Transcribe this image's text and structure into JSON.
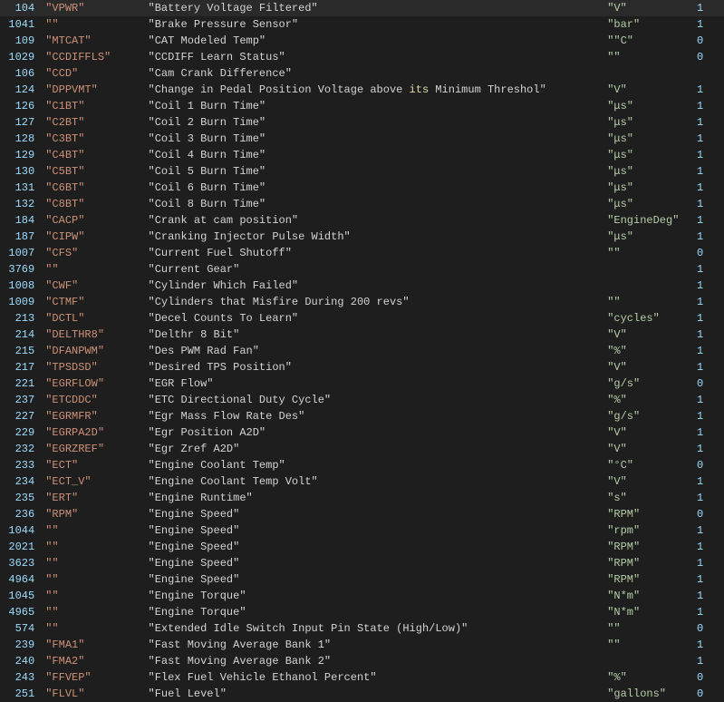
{
  "rows": [
    {
      "id": "104",
      "code": "\"VPWR\"",
      "desc": "\"Battery Voltage Filtered\"",
      "unit": "\"V\"",
      "extra": "",
      "val": "1"
    },
    {
      "id": "1041",
      "code": "\"\"",
      "desc": "\"Brake Pressure Sensor\"",
      "unit": "\"bar\"",
      "extra": "",
      "val": "1"
    },
    {
      "id": "109",
      "code": "\"MTCAT\"",
      "desc": "\"CAT Modeled Temp\"",
      "unit": "\"\"C\"",
      "extra": "",
      "val": "0"
    },
    {
      "id": "1029",
      "code": "\"CCDIFFLS\"",
      "desc": "\"CCDIFF Learn Status\"",
      "unit": "\"\"",
      "extra": "",
      "val": "0"
    },
    {
      "id": "106",
      "code": "\"CCD\"",
      "desc": "\"Cam Crank Difference\"",
      "unit": "",
      "extra": "",
      "val": ""
    },
    {
      "id": "124",
      "code": "\"DPPVMT\"",
      "desc": "\"Change in Pedal Position Voltage above its Minimum Threshol\"",
      "unit": "\"V\"",
      "extra": "",
      "val": "1"
    },
    {
      "id": "126",
      "code": "\"C1BT\"",
      "desc": "\"Coil 1 Burn Time\"",
      "unit": "\"μs\"",
      "extra": "",
      "val": "1"
    },
    {
      "id": "127",
      "code": "\"C2BT\"",
      "desc": "\"Coil 2 Burn Time\"",
      "unit": "\"μs\"",
      "extra": "",
      "val": "1"
    },
    {
      "id": "128",
      "code": "\"C3BT\"",
      "desc": "\"Coil 3 Burn Time\"",
      "unit": "\"μs\"",
      "extra": "",
      "val": "1"
    },
    {
      "id": "129",
      "code": "\"C4BT\"",
      "desc": "\"Coil 4 Burn Time\"",
      "unit": "\"μs\"",
      "extra": "",
      "val": "1"
    },
    {
      "id": "130",
      "code": "\"C5BT\"",
      "desc": "\"Coil 5 Burn Time\"",
      "unit": "\"μs\"",
      "extra": "",
      "val": "1"
    },
    {
      "id": "131",
      "code": "\"C6BT\"",
      "desc": "\"Coil 6 Burn Time\"",
      "unit": "\"μs\"",
      "extra": "",
      "val": "1"
    },
    {
      "id": "132",
      "code": "\"C8BT\"",
      "desc": "\"Coil 8 Burn Time\"",
      "unit": "\"μs\"",
      "extra": "",
      "val": "1"
    },
    {
      "id": "184",
      "code": "\"CACP\"",
      "desc": "\"Crank at cam position\"",
      "unit": "\"EngineDeg\"",
      "extra": "",
      "val": "1"
    },
    {
      "id": "187",
      "code": "\"CIPW\"",
      "desc": "\"Cranking Injector Pulse Width\"",
      "unit": "\"μs\"",
      "extra": "",
      "val": "1"
    },
    {
      "id": "1007",
      "code": "\"CFS\"",
      "desc": "\"Current Fuel Shutoff\"",
      "unit": "\"\"",
      "extra": "",
      "val": "0"
    },
    {
      "id": "3769",
      "code": "\"\"",
      "desc": "\"Current Gear\"",
      "unit": "",
      "extra": "",
      "val": "1"
    },
    {
      "id": "1008",
      "code": "\"CWF\"",
      "desc": "\"Cylinder Which Failed\"",
      "unit": "",
      "extra": "",
      "val": "1"
    },
    {
      "id": "1009",
      "code": "\"CTMF\"",
      "desc": "\"Cylinders that Misfire During 200 revs\"",
      "unit": "\"\"",
      "extra": "",
      "val": "1"
    },
    {
      "id": "213",
      "code": "\"DCTL\"",
      "desc": "\"Decel Counts To Learn\"",
      "unit": "\"cycles\"",
      "extra": "",
      "val": "1"
    },
    {
      "id": "214",
      "code": "\"DELTHR8\"",
      "desc": "\"Delthr 8 Bit\"",
      "unit": "\"V\"",
      "extra": "",
      "val": "1"
    },
    {
      "id": "215",
      "code": "\"DFANPWM\"",
      "desc": "\"Des PWM Rad Fan\"",
      "unit": "\"%\"",
      "extra": "",
      "val": "1"
    },
    {
      "id": "217",
      "code": "\"TPSDSD\"",
      "desc": "\"Desired TPS Position\"",
      "unit": "\"V\"",
      "extra": "",
      "val": "1"
    },
    {
      "id": "221",
      "code": "\"EGRFLOW\"",
      "desc": "\"EGR Flow\"",
      "unit": "\"g/s\"",
      "extra": "",
      "val": "0"
    },
    {
      "id": "237",
      "code": "\"ETCDDC\"",
      "desc": "\"ETC Directional Duty Cycle\"",
      "unit": "\"%\"",
      "extra": "",
      "val": "1"
    },
    {
      "id": "227",
      "code": "\"EGRMFR\"",
      "desc": "\"Egr Mass Flow Rate Des\"",
      "unit": "\"g/s\"",
      "extra": "",
      "val": "1"
    },
    {
      "id": "229",
      "code": "\"EGRPA2D\"",
      "desc": "\"Egr Position A2D\"",
      "unit": "\"V\"",
      "extra": "",
      "val": "1"
    },
    {
      "id": "232",
      "code": "\"EGRZREF\"",
      "desc": "\"Egr Zref A2D\"",
      "unit": "\"V\"",
      "extra": "",
      "val": "1"
    },
    {
      "id": "233",
      "code": "\"ECT\"",
      "desc": "\"Engine Coolant Temp\"",
      "unit": "\"°C\"",
      "extra": "",
      "val": "0"
    },
    {
      "id": "234",
      "code": "\"ECT_V\"",
      "desc": "\"Engine Coolant Temp Volt\"",
      "unit": "\"V\"",
      "extra": "",
      "val": "1"
    },
    {
      "id": "235",
      "code": "\"ERT\"",
      "desc": "\"Engine Runtime\"",
      "unit": "\"s\"",
      "extra": "",
      "val": "1"
    },
    {
      "id": "236",
      "code": "\"RPM\"",
      "desc": "\"Engine Speed\"",
      "unit": "\"RPM\"",
      "extra": "",
      "val": "0"
    },
    {
      "id": "1044",
      "code": "\"\"",
      "desc": "\"Engine Speed\"",
      "unit": "\"rpm\"",
      "extra": "",
      "val": "1"
    },
    {
      "id": "2021",
      "code": "\"\"",
      "desc": "\"Engine Speed\"",
      "unit": "\"RPM\"",
      "extra": "",
      "val": "1"
    },
    {
      "id": "3623",
      "code": "\"\"",
      "desc": "\"Engine Speed\"",
      "unit": "\"RPM\"",
      "extra": "",
      "val": "1"
    },
    {
      "id": "4964",
      "code": "\"\"",
      "desc": "\"Engine Speed\"",
      "unit": "\"RPM\"",
      "extra": "",
      "val": "1"
    },
    {
      "id": "1045",
      "code": "\"\"",
      "desc": "\"Engine Torque\"",
      "unit": "\"N*m\"",
      "extra": "",
      "val": "1"
    },
    {
      "id": "4965",
      "code": "\"\"",
      "desc": "\"Engine Torque\"",
      "unit": "\"N*m\"",
      "extra": "",
      "val": "1"
    },
    {
      "id": "574",
      "code": "\"\"",
      "desc": "\"Extended Idle Switch Input Pin State (High/Low)\"",
      "unit": "\"\"",
      "extra": "",
      "val": "0"
    },
    {
      "id": "239",
      "code": "\"FMA1\"",
      "desc": "\"Fast Moving Average Bank 1\"",
      "unit": "\"\"",
      "extra": "",
      "val": "1"
    },
    {
      "id": "240",
      "code": "\"FMA2\"",
      "desc": "\"Fast Moving Average Bank 2\"",
      "unit": "",
      "extra": "",
      "val": "1"
    },
    {
      "id": "243",
      "code": "\"FFVEP\"",
      "desc": "\"Flex Fuel Vehicle Ethanol Percent\"",
      "unit": "\"%\"",
      "extra": "",
      "val": "0"
    },
    {
      "id": "251",
      "code": "\"FLVL\"",
      "desc": "\"Fuel Level\"",
      "unit": "\"gallons\"",
      "extra": "",
      "val": "0"
    }
  ]
}
